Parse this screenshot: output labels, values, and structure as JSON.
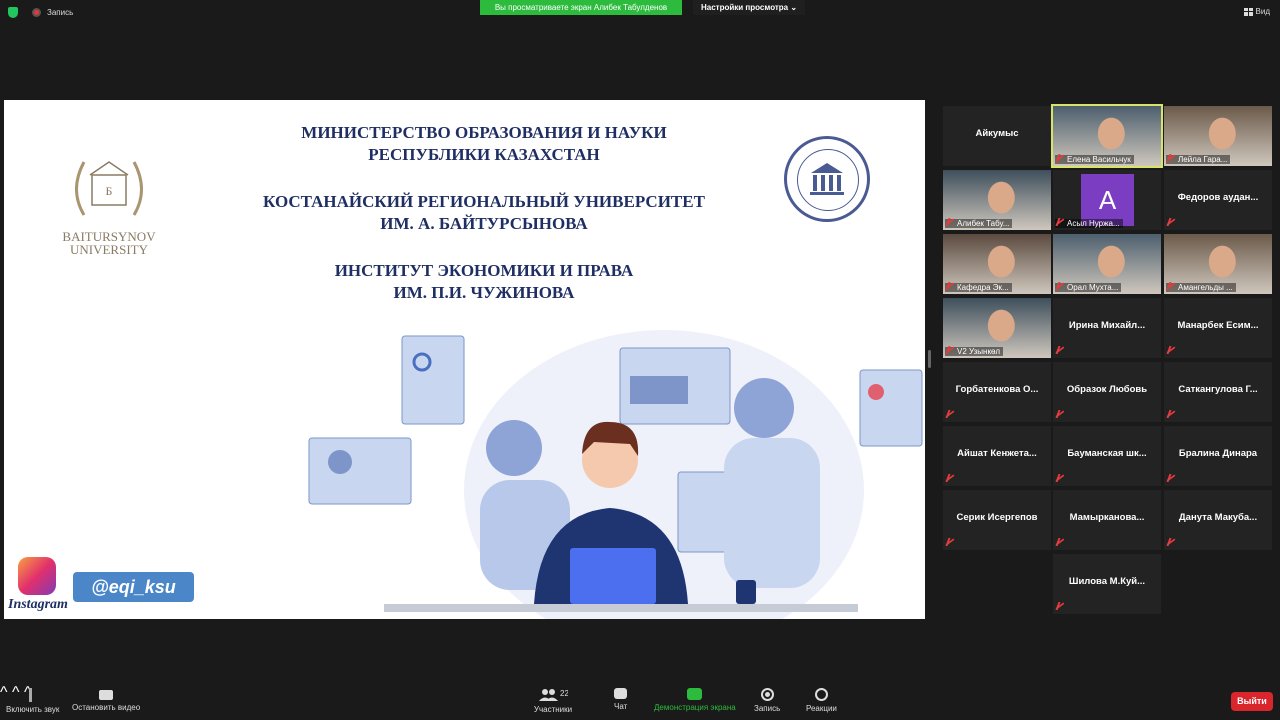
{
  "topbar": {
    "recording_label": "Запись",
    "viewing_banner": "Вы просматриваете экран Алибек Табулденов",
    "view_options": "Настройки просмотра",
    "view_button": "Вид"
  },
  "slide": {
    "line1": "МИНИСТЕРСТВО ОБРАЗОВАНИЯ И НАУКИ",
    "line2": "РЕСПУБЛИКИ КАЗАХСТАН",
    "line3": "КОСТАНАЙСКИЙ РЕГИОНАЛЬНЫЙ УНИВЕРСИТЕТ",
    "line4": "ИМ. А. БАЙТУРСЫНОВА",
    "line5": "ИНСТИТУТ ЭКОНОМИКИ И ПРАВА",
    "line6": "ИМ. П.И. ЧУЖИНОВА",
    "logo_left_line1": "BAITURSYNOV",
    "logo_left_line2": "UNIVERSITY",
    "instagram_label": "Instagram",
    "instagram_handle": "@eqi_ksu"
  },
  "participants": [
    {
      "name": "Айкумыс",
      "video": false
    },
    {
      "name": "Елена Васильчук",
      "video": true,
      "active": true
    },
    {
      "name": "Лейла Гара...",
      "video": true
    },
    {
      "name": "Алибек Табу...",
      "video": true
    },
    {
      "name": "Асыл Нуржа...",
      "avatar": "A"
    },
    {
      "name": "Федоров аудан...",
      "video": false
    },
    {
      "name": "Кафедра Эк...",
      "video": true
    },
    {
      "name": "Орал Мухта...",
      "video": true
    },
    {
      "name": "Амангельды ...",
      "video": true
    },
    {
      "name": "V2 Узынкөл",
      "video": true
    },
    {
      "name": "Ирина Михайл...",
      "video": false
    },
    {
      "name": "Манарбек Есим...",
      "video": false
    },
    {
      "name": "Горбатенкова О...",
      "video": false
    },
    {
      "name": "Образок Любовь",
      "video": false
    },
    {
      "name": "Саткангулова Г...",
      "video": false
    },
    {
      "name": "Айшат Кенжета...",
      "video": false
    },
    {
      "name": "Бауманская шк...",
      "video": false
    },
    {
      "name": "Бралина Динара",
      "video": false
    },
    {
      "name": "Серик Исергепов",
      "video": false
    },
    {
      "name": "Мамырканова...",
      "video": false
    },
    {
      "name": "Данута Макуба...",
      "video": false
    },
    {
      "name": "Шилова М.Куй...",
      "video": false
    }
  ],
  "toolbar": {
    "unmute": "Включить звук",
    "stop_video": "Остановить видео",
    "participants": "Участники",
    "participants_count": "22",
    "chat": "Чат",
    "share": "Демонстрация экрана",
    "record": "Запись",
    "reactions": "Реакции",
    "leave": "Выйти"
  },
  "colors": {
    "share_green": "#2dbb3e",
    "leave_red": "#d9262c",
    "active_speaker": "#d8e36a",
    "slide_navy": "#1f2f63"
  }
}
